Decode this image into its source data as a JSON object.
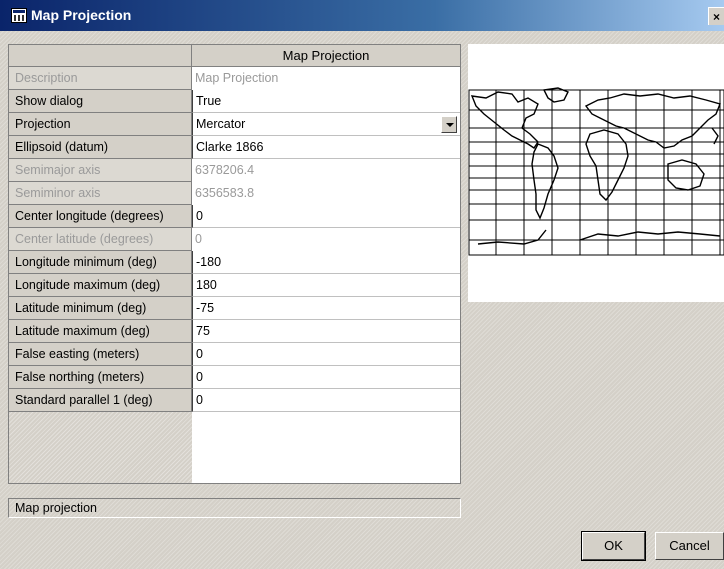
{
  "window": {
    "title": "Map Projection",
    "close_glyph": "×"
  },
  "grid": {
    "column_header": "Map Projection",
    "rows": [
      {
        "label": "Description",
        "value": "Map Projection",
        "disabled": true
      },
      {
        "label": "Show dialog",
        "value": "True",
        "disabled": false
      },
      {
        "label": "Projection",
        "value": "Mercator",
        "disabled": false,
        "dropdown": true
      },
      {
        "label": "Ellipsoid (datum)",
        "value": "Clarke 1866",
        "disabled": false
      },
      {
        "label": "Semimajor axis",
        "value": "6378206.4",
        "disabled": true
      },
      {
        "label": "Semiminor axis",
        "value": "6356583.8",
        "disabled": true
      },
      {
        "label": "Center longitude (degrees)",
        "value": "0",
        "disabled": false
      },
      {
        "label": "Center latitude (degrees)",
        "value": "0",
        "disabled": true
      },
      {
        "label": "Longitude minimum (deg)",
        "value": "-180",
        "disabled": false
      },
      {
        "label": "Longitude maximum (deg)",
        "value": "180",
        "disabled": false
      },
      {
        "label": "Latitude minimum (deg)",
        "value": "-75",
        "disabled": false
      },
      {
        "label": "Latitude maximum (deg)",
        "value": "75",
        "disabled": false
      },
      {
        "label": "False easting (meters)",
        "value": "0",
        "disabled": false
      },
      {
        "label": "False northing (meters)",
        "value": "0",
        "disabled": false
      },
      {
        "label": "Standard parallel 1 (deg)",
        "value": "0",
        "disabled": false
      }
    ]
  },
  "status": {
    "text": "Map projection"
  },
  "buttons": {
    "ok": "OK",
    "cancel": "Cancel"
  },
  "preview": {
    "icon": "world-map-mercator-grid"
  }
}
